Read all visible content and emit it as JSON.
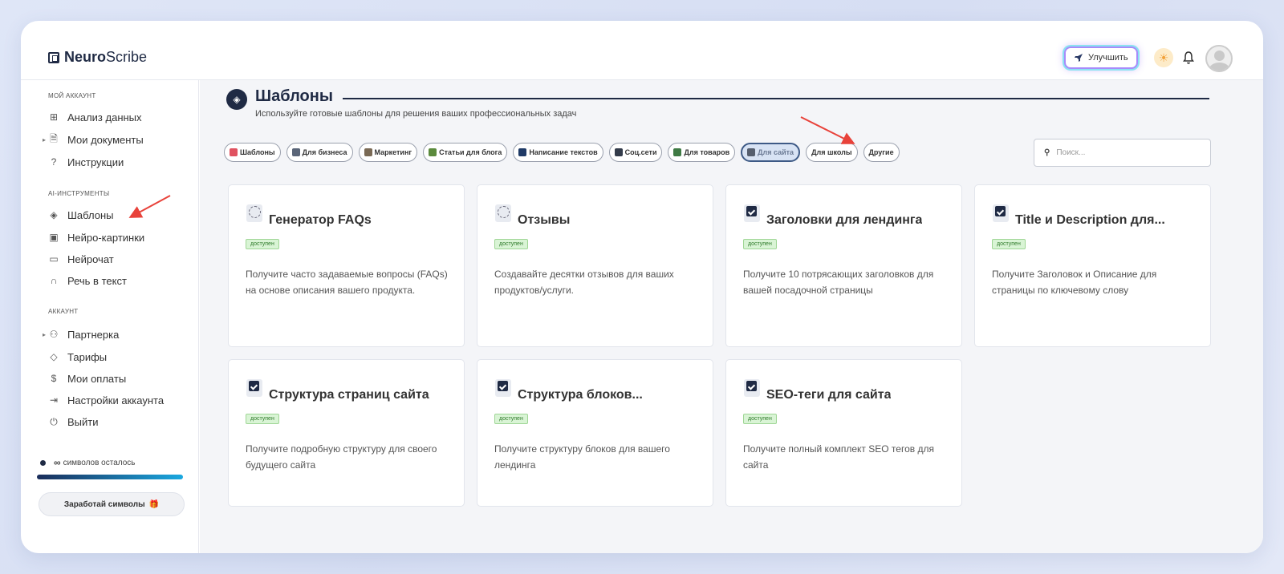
{
  "app": {
    "logo_bold": "Neuro",
    "logo_rest": "Scribe"
  },
  "header": {
    "upgrade_label": "Улучшить"
  },
  "sidebar": {
    "sections": [
      {
        "label": "МОЙ АККАУНТ"
      },
      {
        "label": "AI-ИНСТРУМЕНТЫ"
      },
      {
        "label": "АККАУНТ"
      }
    ],
    "items": [
      {
        "label": "Анализ данных",
        "icon": "grid-icon"
      },
      {
        "label": "Мои документы",
        "icon": "document-icon"
      },
      {
        "label": "Инструкции",
        "icon": "help-circle-icon"
      },
      {
        "label": "Шаблоны",
        "icon": "layers-icon"
      },
      {
        "label": "Нейро-картинки",
        "icon": "image-icon"
      },
      {
        "label": "Нейрочат",
        "icon": "chat-icon"
      },
      {
        "label": "Речь в текст",
        "icon": "headphones-icon"
      },
      {
        "label": "Партнерка",
        "icon": "users-icon"
      },
      {
        "label": "Тарифы",
        "icon": "tag-icon"
      },
      {
        "label": "Мои оплаты",
        "icon": "dollar-icon"
      },
      {
        "label": "Настройки аккаунта",
        "icon": "login-icon"
      },
      {
        "label": "Выйти",
        "icon": "power-icon"
      }
    ],
    "credits_symbol": "∞",
    "credits_text": "символов осталось",
    "credits_fill": 1.0,
    "earn_label": "Заработай символы"
  },
  "main": {
    "title": "Шаблоны",
    "subtitle": "Используйте готовые шаблоны для решения ваших профессиональных задач",
    "search_placeholder": "Поиск...",
    "chips": [
      {
        "label": "Шаблоны",
        "color": "#e05260"
      },
      {
        "label": "Для бизнеса",
        "color": "#5a6578"
      },
      {
        "label": "Маркетинг",
        "color": "#7a6a55"
      },
      {
        "label": "Статьи для блога",
        "color": "#5b8a3c"
      },
      {
        "label": "Написание текстов",
        "color": "#1f3a66"
      },
      {
        "label": "Соц.сети",
        "color": "#333b4a"
      },
      {
        "label": "Для товаров",
        "color": "#3f7a44"
      },
      {
        "label": "Для сайта",
        "color": "#555e6e"
      },
      {
        "label": "Для школы",
        "color": ""
      },
      {
        "label": "Другие",
        "color": ""
      }
    ],
    "cards": [
      {
        "title": "Генератор FAQs",
        "badge": "доступен",
        "desc": "Получите часто задаваемые вопросы (FAQs) на основе описания вашего продукта.",
        "icon": "clock-icon"
      },
      {
        "title": "Отзывы",
        "badge": "доступен",
        "desc": "Создавайте десятки отзывов для ваших продуктов/услуги.",
        "icon": "clock-icon"
      },
      {
        "title": "Заголовки для лендинга",
        "badge": "доступен",
        "desc": "Получите 10 потрясающих заголовков для вашей посадочной страницы",
        "icon": "checkbox-icon"
      },
      {
        "title": "Title и Description для...",
        "badge": "доступен",
        "desc": "Получите Заголовок и Описание для страницы по ключевому слову",
        "icon": "checkbox-icon"
      },
      {
        "title": "Структура страниц сайта",
        "badge": "доступен",
        "desc": "Получите подробную структуру для своего будущего сайта",
        "icon": "checkbox-icon"
      },
      {
        "title": "Структура блоков...",
        "badge": "доступен",
        "desc": "Получите структуру блоков для вашего лендинга",
        "icon": "checkbox-icon"
      },
      {
        "title": "SEO-теги для сайта",
        "badge": "доступен",
        "desc": "Получите полный комплект SEO тегов для сайта",
        "icon": "checkbox-icon"
      }
    ]
  },
  "colors": {
    "accent": "#1f2a44",
    "badge_bg": "#d9f4d5",
    "arrow": "#e8423a"
  }
}
